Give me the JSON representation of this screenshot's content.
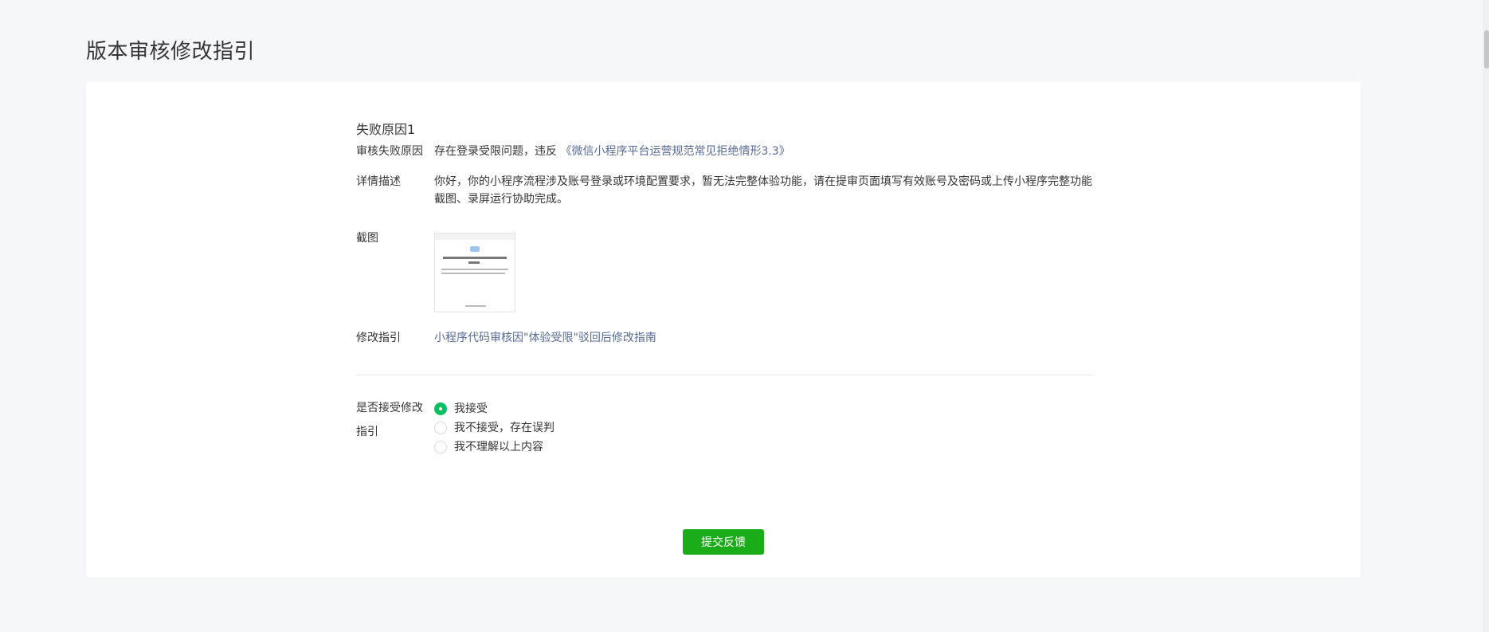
{
  "page": {
    "title": "版本审核修改指引"
  },
  "reason": {
    "section_title": "失败原因1",
    "fail_reason_label": "审核失败原因",
    "fail_reason_text": "存在登录受限问题，违反",
    "fail_reason_link": "《微信小程序平台运营规范常见拒绝情形3.3》",
    "detail_label": "详情描述",
    "detail_text": "你好，你的小程序流程涉及账号登录或环境配置要求，暂无法完整体验功能，请在提审页面填写有效账号及密码或上传小程序完整功能截图、录屏运行协助完成。",
    "screenshot_label": "截图",
    "guide_label": "修改指引",
    "guide_link": "小程序代码审核因\"体验受限\"驳回后修改指南"
  },
  "accept": {
    "label": "是否接受修改指引",
    "options": [
      {
        "label": "我接受",
        "checked": true
      },
      {
        "label": "我不接受，存在误判",
        "checked": false
      },
      {
        "label": "我不理解以上内容",
        "checked": false
      }
    ]
  },
  "submit": {
    "label": "提交反馈"
  },
  "colors": {
    "accent": "#1aad19",
    "radio_checked": "#07c160",
    "link": "#576b95",
    "background": "#f6f7f9"
  }
}
